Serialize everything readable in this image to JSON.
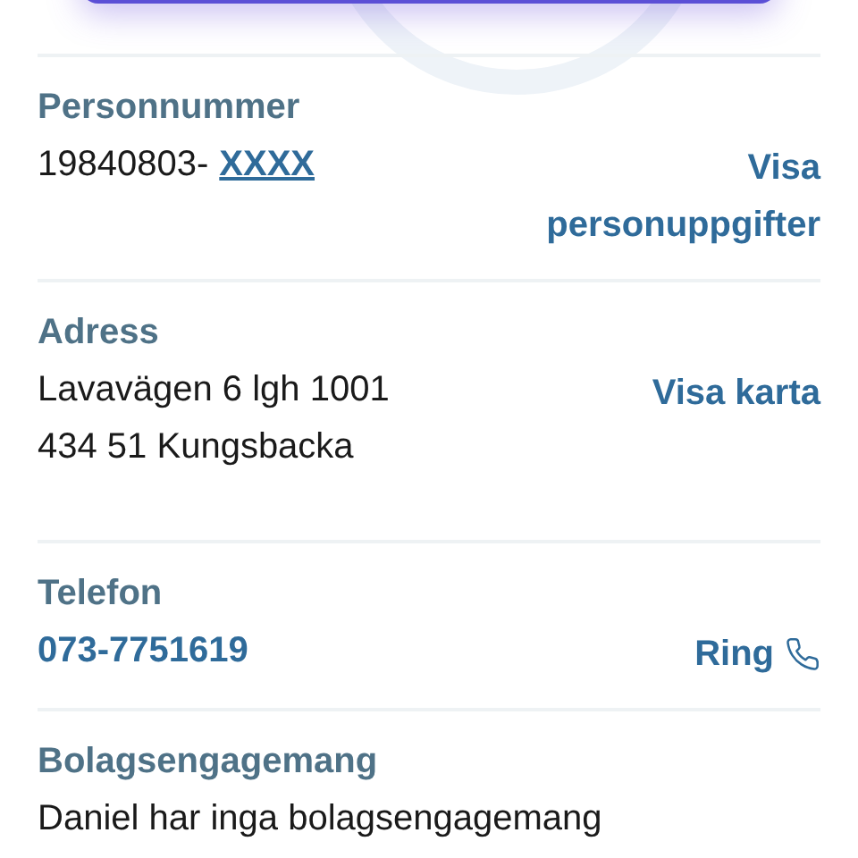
{
  "sections": [
    {
      "kind": "masked",
      "label": "Personnummer",
      "lines": [
        {
          "text": "19840803-",
          "masked": "XXXX"
        }
      ],
      "action": {
        "label": "Visa personuppgifter"
      }
    },
    {
      "kind": "address",
      "label": "Adress",
      "lines": [
        {
          "text": "Lavavägen 6 lgh 1001"
        },
        {
          "text": "434 51 Kungsbacka"
        }
      ],
      "action": {
        "label": "Visa karta"
      }
    },
    {
      "kind": "phone",
      "label": "Telefon",
      "lines": [
        {
          "text": "073-7751619"
        }
      ],
      "action": {
        "label": "Ring"
      }
    },
    {
      "kind": "text",
      "label": "Bolagsengagemang",
      "lines": [
        {
          "text": "Daniel har inga bolagsengagemang"
        }
      ]
    }
  ]
}
